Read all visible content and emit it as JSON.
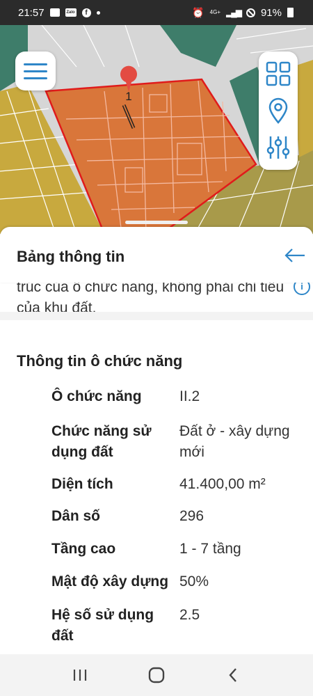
{
  "status_bar": {
    "time": "21:57",
    "zalo_label": "Zalo",
    "fb_label": "f",
    "network": "4G+",
    "battery": "91%"
  },
  "map": {
    "marker_label": "1",
    "colors": {
      "land_yellow": "#c8a93e",
      "land_brown": "#a89a4a",
      "selected_fill": "#d9763a",
      "selected_border": "#e01b1b",
      "road": "#ffffff",
      "green_block": "#3e7d6a",
      "marker": "#e34b42"
    }
  },
  "icons": {
    "menu": "menu-icon",
    "grid": "grid-icon",
    "location": "location-pin-icon",
    "filter": "filter-sliders-icon",
    "back": "arrow-left-icon",
    "info": "info-icon"
  },
  "info_sheet": {
    "title": "Bảng thông tin",
    "note": "trúc của ô chức năng, không phải chỉ tiêu của khu đất.",
    "info_glyph": "i",
    "section_title": "Thông tin ô chức năng",
    "attributes": [
      {
        "key": "Ô chức năng",
        "value": "II.2"
      },
      {
        "key": "Chức năng sử dụng đất",
        "value": "Đất ở - xây dựng mới"
      },
      {
        "key": "Diện tích",
        "value": "41.400,00 m²"
      },
      {
        "key": "Dân số",
        "value": "296"
      },
      {
        "key": "Tầng cao",
        "value": "1 - 7 tầng"
      },
      {
        "key": "Mật độ xây dựng",
        "value": "50%"
      },
      {
        "key": "Hệ số sử dụng đất",
        "value": "2.5"
      }
    ]
  },
  "accent_color": "#2e86c8"
}
